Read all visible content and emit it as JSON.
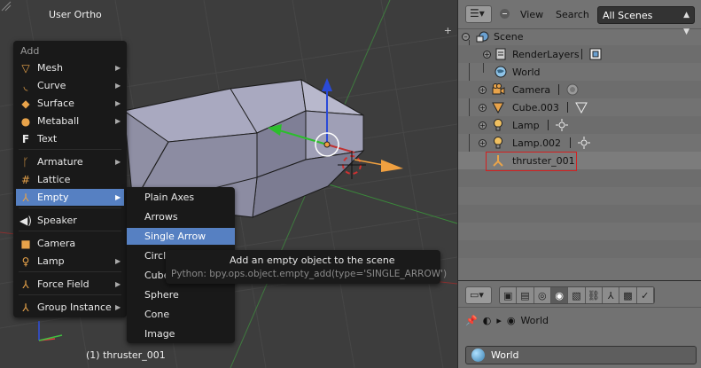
{
  "viewport": {
    "title": "User Ortho",
    "status": "(1) thruster_001",
    "plus_glyph": "+"
  },
  "add_menu": {
    "title": "Add",
    "items": [
      {
        "label": "Mesh",
        "icon": "mesh-icon",
        "submenu": true
      },
      {
        "label": "Curve",
        "icon": "curve-icon",
        "submenu": true
      },
      {
        "label": "Surface",
        "icon": "surface-icon",
        "submenu": true
      },
      {
        "label": "Metaball",
        "icon": "metaball-icon",
        "submenu": true
      },
      {
        "label": "Text",
        "icon": "text-icon",
        "submenu": false
      },
      {
        "label": "Armature",
        "icon": "armature-icon",
        "submenu": true
      },
      {
        "label": "Lattice",
        "icon": "lattice-icon",
        "submenu": false
      },
      {
        "label": "Empty",
        "icon": "empty-icon",
        "submenu": true
      },
      {
        "label": "Speaker",
        "icon": "speaker-icon",
        "submenu": false
      },
      {
        "label": "Camera",
        "icon": "camera-icon",
        "submenu": false
      },
      {
        "label": "Lamp",
        "icon": "lamp-icon",
        "submenu": true
      },
      {
        "label": "Force Field",
        "icon": "force-field-icon",
        "submenu": true
      },
      {
        "label": "Group Instance",
        "icon": "group-instance-icon",
        "submenu": true
      }
    ],
    "active": "Empty"
  },
  "empty_submenu": {
    "items": [
      "Plain Axes",
      "Arrows",
      "Single Arrow",
      "Circle",
      "Cube",
      "Sphere",
      "Cone",
      "Image"
    ],
    "active": "Single Arrow"
  },
  "tooltip": {
    "description": "Add an empty object to the scene",
    "python": "Python: bpy.ops.object.empty_add(type='SINGLE_ARROW')"
  },
  "outliner": {
    "menus": [
      "View",
      "Search"
    ],
    "scene_filter": "All Scenes",
    "rows": [
      {
        "label": "Scene",
        "icon": "scene-icon"
      },
      {
        "label": "RenderLayers",
        "icon": "render-layers-icon"
      },
      {
        "label": "World",
        "icon": "world-icon"
      },
      {
        "label": "Camera",
        "icon": "camera-object-icon"
      },
      {
        "label": "Cube.003",
        "icon": "mesh-object-icon"
      },
      {
        "label": "Lamp",
        "icon": "lamp-object-icon"
      },
      {
        "label": "Lamp.002",
        "icon": "lamp-object-icon"
      },
      {
        "label": "thruster_001",
        "icon": "empty-object-icon"
      }
    ]
  },
  "properties": {
    "breadcrumb": "World",
    "world_field": "World"
  },
  "colors": {
    "menu_highlight": "#5680c2",
    "selection_box": "#d42020",
    "axis_x": "#e04040",
    "axis_y": "#40c040",
    "axis_z": "#3050e0",
    "arrow_empty": "#f0a040"
  }
}
